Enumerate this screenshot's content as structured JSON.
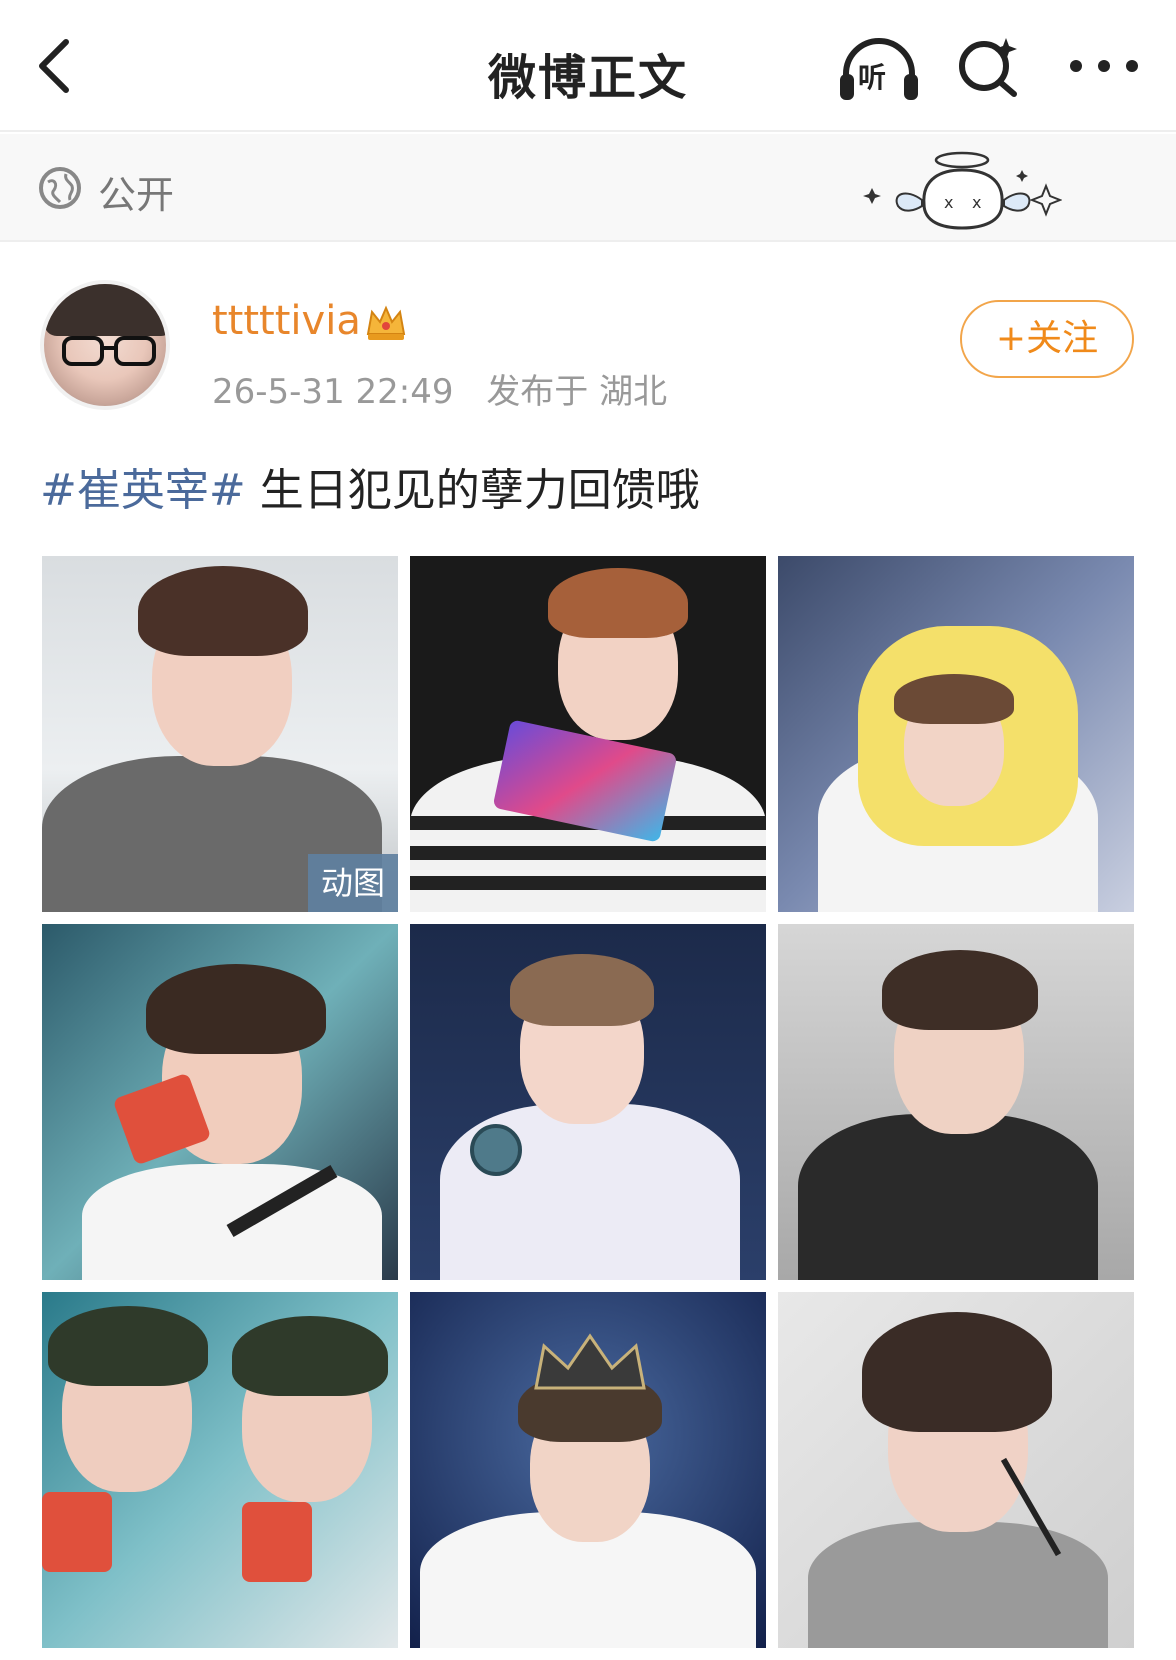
{
  "header": {
    "title": "微博正文",
    "listen_label": "听"
  },
  "visibility": {
    "label": "公开"
  },
  "post": {
    "author": {
      "name": "tttttivia"
    },
    "time": "26-5-31 22:49",
    "location": "发布于 湖北",
    "follow_label": "+关注",
    "hashtag": "#崔英宰#",
    "text": " 生日犯见的孽力回馈哦",
    "images": [
      {
        "alt": "photo-1",
        "badge": "动图"
      },
      {
        "alt": "photo-2"
      },
      {
        "alt": "photo-3"
      },
      {
        "alt": "photo-4"
      },
      {
        "alt": "photo-5"
      },
      {
        "alt": "photo-6"
      },
      {
        "alt": "photo-7"
      },
      {
        "alt": "photo-8"
      },
      {
        "alt": "photo-9"
      }
    ]
  },
  "colors": {
    "accent_orange": "#f08a1a",
    "hashtag_blue": "#4b6a9b",
    "meta_gray": "#999999"
  },
  "icons": {
    "back": "chevron-left-icon",
    "listen": "headphones-icon",
    "search": "search-sparkle-icon",
    "more": "more-dots-icon",
    "visibility": "globe-icon",
    "vip": "crown-icon"
  }
}
